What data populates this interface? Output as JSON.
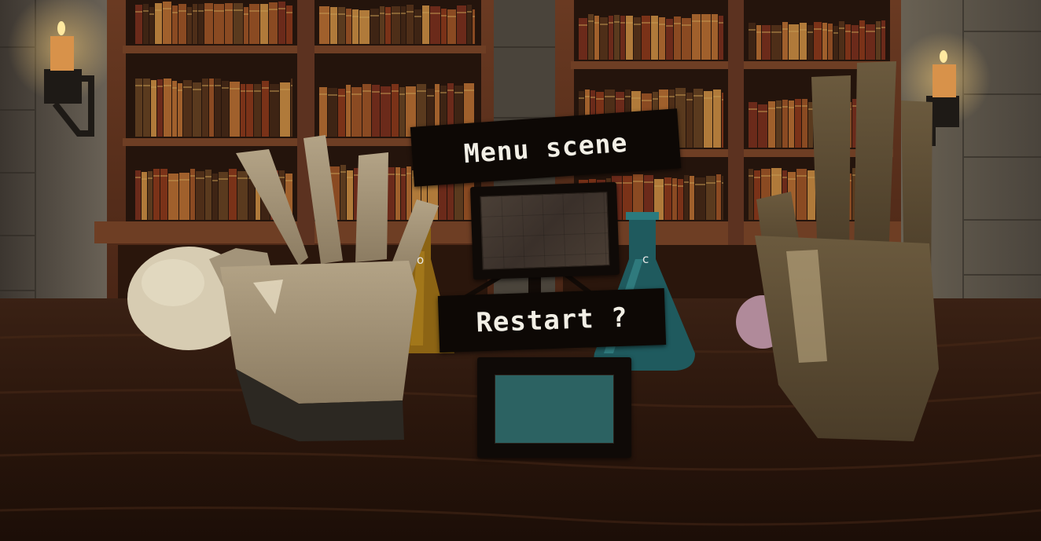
{
  "menu": {
    "menu_scene_label": "Menu scene",
    "restart_label": "Restart ?"
  },
  "pointers": {
    "left_glyph": "o",
    "right_glyph": "c"
  },
  "colors": {
    "sign_background": "#0d0805",
    "sign_text": "#f2efe6",
    "restart_pad_face": "#2c6262",
    "menu_pad_face": "#3f352d"
  },
  "icons": {
    "menu_pad": "button-pad-icon",
    "restart_pad": "button-pad-icon",
    "left_hand": "left-hand-icon",
    "right_hand": "right-hand-icon"
  }
}
